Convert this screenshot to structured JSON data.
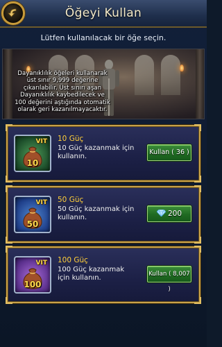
{
  "header": {
    "title": "Öğeyi Kullan"
  },
  "subtitle": "Lütfen kullanılacak bir öğe seçin.",
  "banner": {
    "lines": [
      "Dayanıklılık öğeleri kullanarak",
      "üst sınır 9,999 değerine",
      "çıkarılabilir. Üst sınırı aşan",
      "Dayanıklılık kaybedilecek ve",
      "100 değerini aştığında otomatik",
      "olarak geri kazanılmayacaktır."
    ]
  },
  "items": [
    {
      "badge": "VIT",
      "quantity": "10",
      "name": "10 Güç",
      "desc": "10 Güç kazanmak için kullanın.",
      "button": "Kullan ( 36 )",
      "color": "#2f7a3a"
    },
    {
      "badge": "VIT",
      "quantity": "50",
      "name": "50 Güç",
      "desc": "50 Güç kazanmak için kullanın.",
      "button": "200",
      "button_icon": "diamond-icon",
      "color": "#2c56b0"
    },
    {
      "badge": "VIT",
      "quantity": "100",
      "name": "100 Güç",
      "desc": "100 Güç kazanmak için kullanın.",
      "button": "Kullan ( 8,007 )",
      "color": "#7a3fb0"
    }
  ]
}
